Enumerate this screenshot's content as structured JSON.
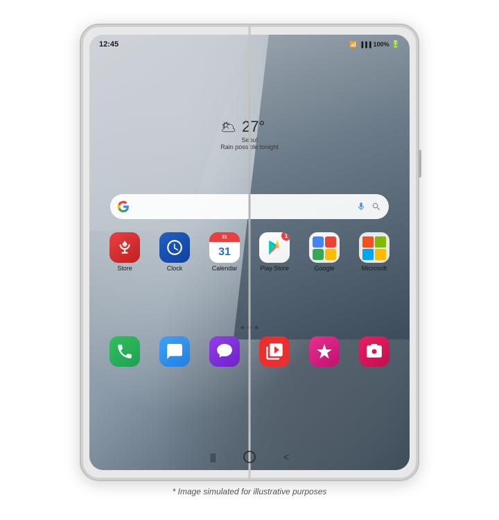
{
  "device": {
    "screen": {
      "status_bar": {
        "time": "12:45",
        "battery": "100%",
        "wifi": "📶",
        "signal": "all"
      },
      "weather": {
        "icon": "🌥",
        "temp": "27°",
        "city": "Seoul",
        "desc": "Rain possible tonight"
      },
      "search": {
        "placeholder": ""
      },
      "app_rows": [
        [
          {
            "label": "Store",
            "style": "icon-store"
          },
          {
            "label": "Clock",
            "style": "icon-clock"
          },
          {
            "label": "Calendar",
            "style": "icon-calendar"
          },
          {
            "label": "Play Store",
            "style": "icon-playstore",
            "badge": "1"
          },
          {
            "label": "Google",
            "style": "icon-google"
          },
          {
            "label": "Microsoft",
            "style": "icon-microsoft"
          }
        ],
        [
          {
            "label": "",
            "style": "icon-phone"
          },
          {
            "label": "",
            "style": "icon-messages"
          },
          {
            "label": "",
            "style": "icon-samsung-msg"
          },
          {
            "label": "",
            "style": "icon-youtubetv"
          },
          {
            "label": "",
            "style": "icon-astro"
          },
          {
            "label": "",
            "style": "icon-camera"
          }
        ]
      ],
      "page_dots": [
        false,
        true,
        false
      ],
      "nav": {
        "recents": "|||",
        "home": "○",
        "back": "<"
      }
    }
  },
  "caption": "* Image simulated for illustrative purposes"
}
